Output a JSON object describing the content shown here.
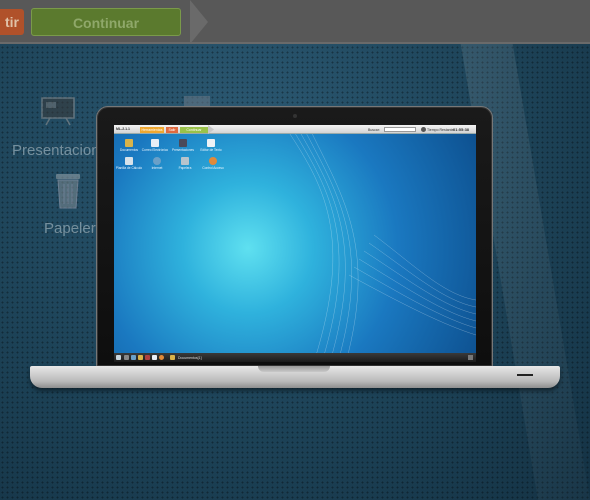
{
  "background": {
    "buttons": {
      "left_label": "tir",
      "continue_label": "Continuar"
    },
    "icons": [
      {
        "label": "Presentacion",
        "icon": "presentation-board-icon"
      },
      {
        "label": "Papelera",
        "icon": "trash-bin-icon"
      }
    ]
  },
  "inner_screen": {
    "top_bar": {
      "brand": "ML-2.1.1",
      "button_orange": "Herramientas",
      "button_red": "Salir",
      "button_green": "Continuar",
      "search_label": "Buscar:",
      "time_label": "Tiempo Restante:",
      "time_value": "01:55:38"
    },
    "desktop_icons": [
      {
        "label": "Documentos",
        "icon": "folder-icon",
        "color": "#d9b34a"
      },
      {
        "label": "Correo Electrónico",
        "icon": "mail-icon",
        "color": "#e8eef6"
      },
      {
        "label": "Presentaciones",
        "icon": "presentation-icon",
        "color": "#4a4a5a"
      },
      {
        "label": "Editor de Texto",
        "icon": "text-editor-icon",
        "color": "#eef2f6"
      },
      {
        "label": "Planilla de Cálculo",
        "icon": "spreadsheet-icon",
        "color": "#d8e2ea"
      },
      {
        "label": "Internet",
        "icon": "globe-icon",
        "color": "#6aa0c8"
      },
      {
        "label": "Papelera",
        "icon": "trash-icon",
        "color": "#b8c4cc"
      },
      {
        "label": "Control Acceso",
        "icon": "access-control-icon",
        "color": "#e08a3a"
      }
    ],
    "taskbar": {
      "item_label": "Documentos[1]"
    }
  },
  "colors": {
    "desktop_glow": "#5fe0f0",
    "desktop_edge": "#0d4f8e",
    "page_bg": "#1d4358"
  }
}
